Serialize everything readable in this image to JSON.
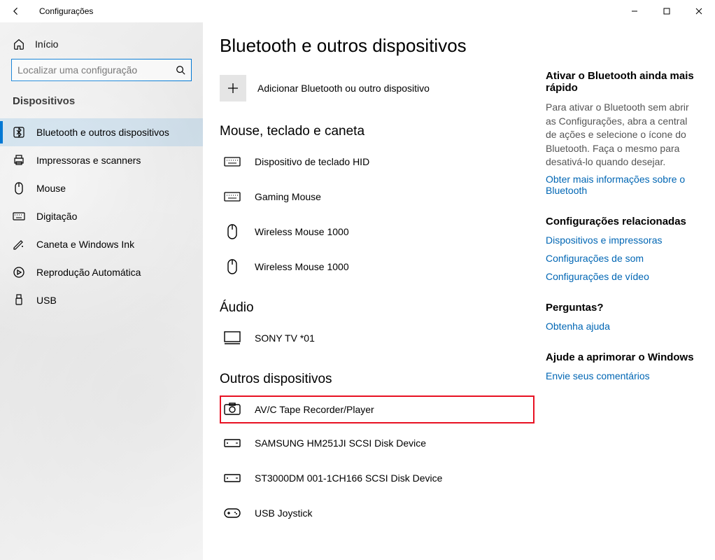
{
  "titlebar": {
    "title": "Configurações"
  },
  "sidebar": {
    "home": "Início",
    "search_placeholder": "Localizar uma configuração",
    "category": "Dispositivos",
    "items": [
      {
        "label": "Bluetooth e outros dispositivos",
        "icon": "bluetooth",
        "selected": true
      },
      {
        "label": "Impressoras e scanners",
        "icon": "printer"
      },
      {
        "label": "Mouse",
        "icon": "mouse"
      },
      {
        "label": "Digitação",
        "icon": "keyboard"
      },
      {
        "label": "Caneta e Windows Ink",
        "icon": "pen"
      },
      {
        "label": "Reprodução Automática",
        "icon": "autoplay"
      },
      {
        "label": "USB",
        "icon": "usb"
      }
    ]
  },
  "page": {
    "heading": "Bluetooth e outros dispositivos",
    "add_label": "Adicionar Bluetooth ou outro dispositivo",
    "groups": {
      "input_heading": "Mouse, teclado e caneta",
      "input_devices": [
        {
          "label": "Dispositivo de teclado HID",
          "icon": "keyboard"
        },
        {
          "label": "Gaming Mouse",
          "icon": "keyboard"
        },
        {
          "label": "Wireless Mouse 1000",
          "icon": "mouse"
        },
        {
          "label": "Wireless Mouse 1000",
          "icon": "mouse"
        }
      ],
      "audio_heading": "Áudio",
      "audio_devices": [
        {
          "label": "SONY TV  *01",
          "icon": "monitor"
        }
      ],
      "other_heading": "Outros dispositivos",
      "other_devices": [
        {
          "label": "AV/C Tape Recorder/Player",
          "icon": "camera",
          "highlight": true
        },
        {
          "label": "SAMSUNG HM251JI SCSI Disk Device",
          "icon": "drive"
        },
        {
          "label": "ST3000DM 001-1CH166 SCSI Disk Device",
          "icon": "drive"
        },
        {
          "label": "USB Joystick",
          "icon": "gamepad"
        }
      ]
    }
  },
  "aside": {
    "bt_heading": "Ativar o Bluetooth ainda mais rápido",
    "bt_body": "Para ativar o Bluetooth sem abrir as Configurações, abra a central de ações e selecione o ícone do Bluetooth. Faça o mesmo para desativá-lo quando desejar.",
    "bt_link": "Obter mais informações sobre o Bluetooth",
    "related_heading": "Configurações relacionadas",
    "related_links": [
      "Dispositivos e impressoras",
      "Configurações de som",
      "Configurações de vídeo"
    ],
    "help_heading": "Perguntas?",
    "help_link": "Obtenha ajuda",
    "improve_heading": "Ajude a aprimorar o Windows",
    "improve_link": "Envie seus comentários"
  }
}
